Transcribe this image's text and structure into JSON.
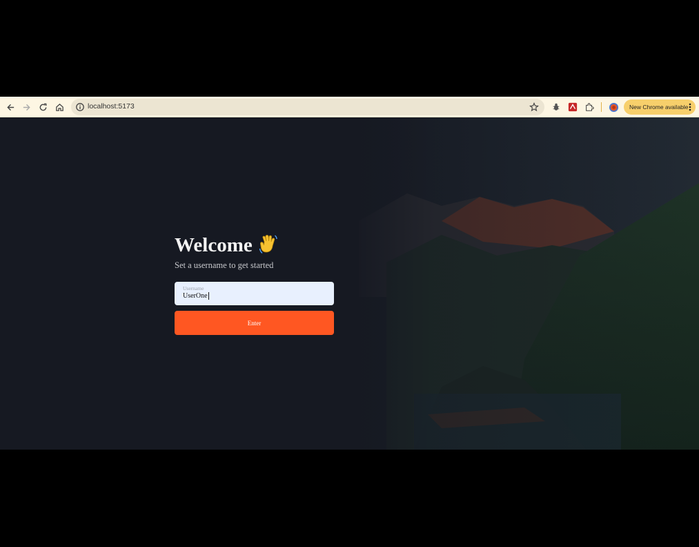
{
  "browser": {
    "url": "localhost:5173",
    "update_label": "New Chrome available",
    "icons": [
      "back-arrow-icon",
      "forward-arrow-icon",
      "reload-icon",
      "home-icon",
      "site-info-icon",
      "bookmark-star-icon",
      "bug-extension-icon",
      "red-extension-icon",
      "puzzle-extensions-icon",
      "profile-avatar-icon",
      "kebab-menu-icon"
    ]
  },
  "login": {
    "title": "Welcome",
    "subtitle": "Set a username to get started",
    "username_placeholder": "Username",
    "username_value": "UserOne",
    "enter_label": "Enter"
  },
  "colors": {
    "page_background": "#161922",
    "button": "#ff5722",
    "input_background": "#e8f0fe",
    "toolbar": "#fdf6e3",
    "update_pill": "#f7cf6b"
  }
}
